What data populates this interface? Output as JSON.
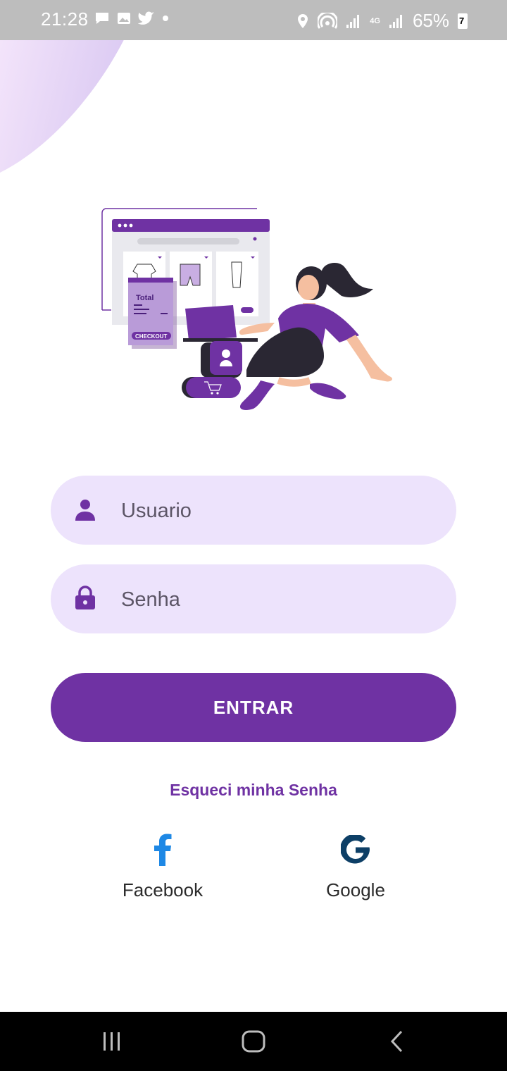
{
  "status_bar": {
    "time": "21:28",
    "battery_percent": "65%",
    "battery_charging_badge": "7",
    "network_label": "4G",
    "notification_icons": [
      "message-icon",
      "image-icon",
      "twitter-icon",
      "dot-icon"
    ],
    "system_icons": [
      "location-icon",
      "hotspot-icon",
      "signal-icon",
      "4g-signal-icon",
      "signal-icon",
      "battery-icon"
    ]
  },
  "illustration": {
    "total_label": "Total",
    "checkout_label": "CHECKOUT"
  },
  "login": {
    "username_placeholder": "Usuario",
    "password_placeholder": "Senha",
    "enter_label": "ENTRAR",
    "forgot_label": "Esqueci minha Senha"
  },
  "social": {
    "facebook_label": "Facebook",
    "google_label": "Google"
  },
  "colors": {
    "accent": "#6f32a3",
    "field_bg": "#ede3fc",
    "status_bar": "#bdbdbd",
    "facebook_blue": "#1e88e5",
    "google_navy": "#0d3f66"
  },
  "nav_bar": {
    "items": [
      "recents-icon",
      "home-icon",
      "back-icon"
    ]
  }
}
